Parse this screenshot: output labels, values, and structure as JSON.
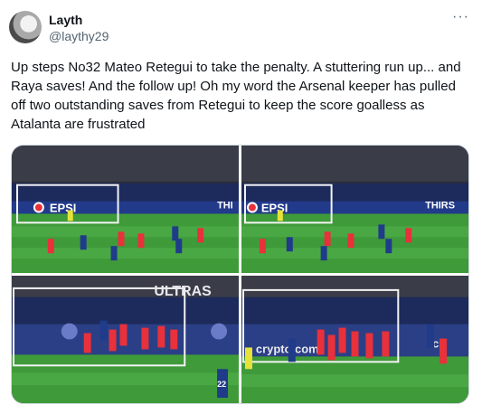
{
  "author": {
    "display_name": "Layth",
    "handle": "@laythy29"
  },
  "menu": {
    "more_label": "···"
  },
  "tweet": {
    "text": "Up steps No32 Mateo Retegui to take the penalty. A stuttering run up... and Raya saves! And the follow up! Oh my word the Arsenal keeper has pulled off two outstanding saves from Retegui to keep the score goalless as Atalanta are frustrated"
  },
  "media": {
    "photos": [
      {
        "board_text": "EPSI",
        "right_text": "THI"
      },
      {
        "board_text": "EPSI",
        "right_text": "THIRS"
      },
      {
        "board_text": "ULTRAS",
        "player_number": "22"
      },
      {
        "board_text": "crypto.com",
        "right_text": "cr"
      }
    ]
  },
  "colors": {
    "pitch": "#3f9a3a",
    "stands": "#2c2f3a",
    "arsenal_red": "#e8313a",
    "atalanta_blue": "#1f3b8a",
    "keeper_yellow": "#e7e23a"
  }
}
